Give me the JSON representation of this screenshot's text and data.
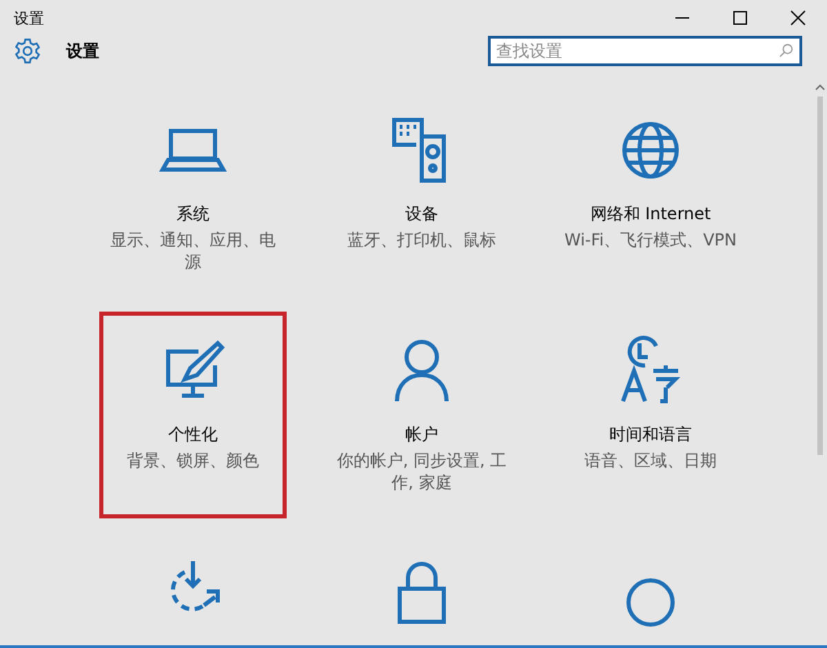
{
  "window": {
    "title": "设置"
  },
  "header": {
    "title": "设置"
  },
  "search": {
    "placeholder": "查找设置"
  },
  "tiles": [
    {
      "kind": "system",
      "title": "系统",
      "description": "显示、通知、应用、电源",
      "highlighted": false
    },
    {
      "kind": "devices",
      "title": "设备",
      "description": "蓝牙、打印机、鼠标",
      "highlighted": false
    },
    {
      "kind": "network",
      "title": "网络和 Internet",
      "description": "Wi-Fi、飞行模式、VPN",
      "highlighted": false
    },
    {
      "kind": "personalization",
      "title": "个性化",
      "description": "背景、锁屏、颜色",
      "highlighted": true
    },
    {
      "kind": "accounts",
      "title": "帐户",
      "description": "你的帐户, 同步设置, 工作, 家庭",
      "highlighted": false
    },
    {
      "kind": "time",
      "title": "时间和语言",
      "description": "语音、区域、日期",
      "highlighted": false
    },
    {
      "kind": "update",
      "highlighted": false
    },
    {
      "kind": "lock",
      "highlighted": false
    },
    {
      "kind": "ease",
      "highlighted": false
    }
  ]
}
